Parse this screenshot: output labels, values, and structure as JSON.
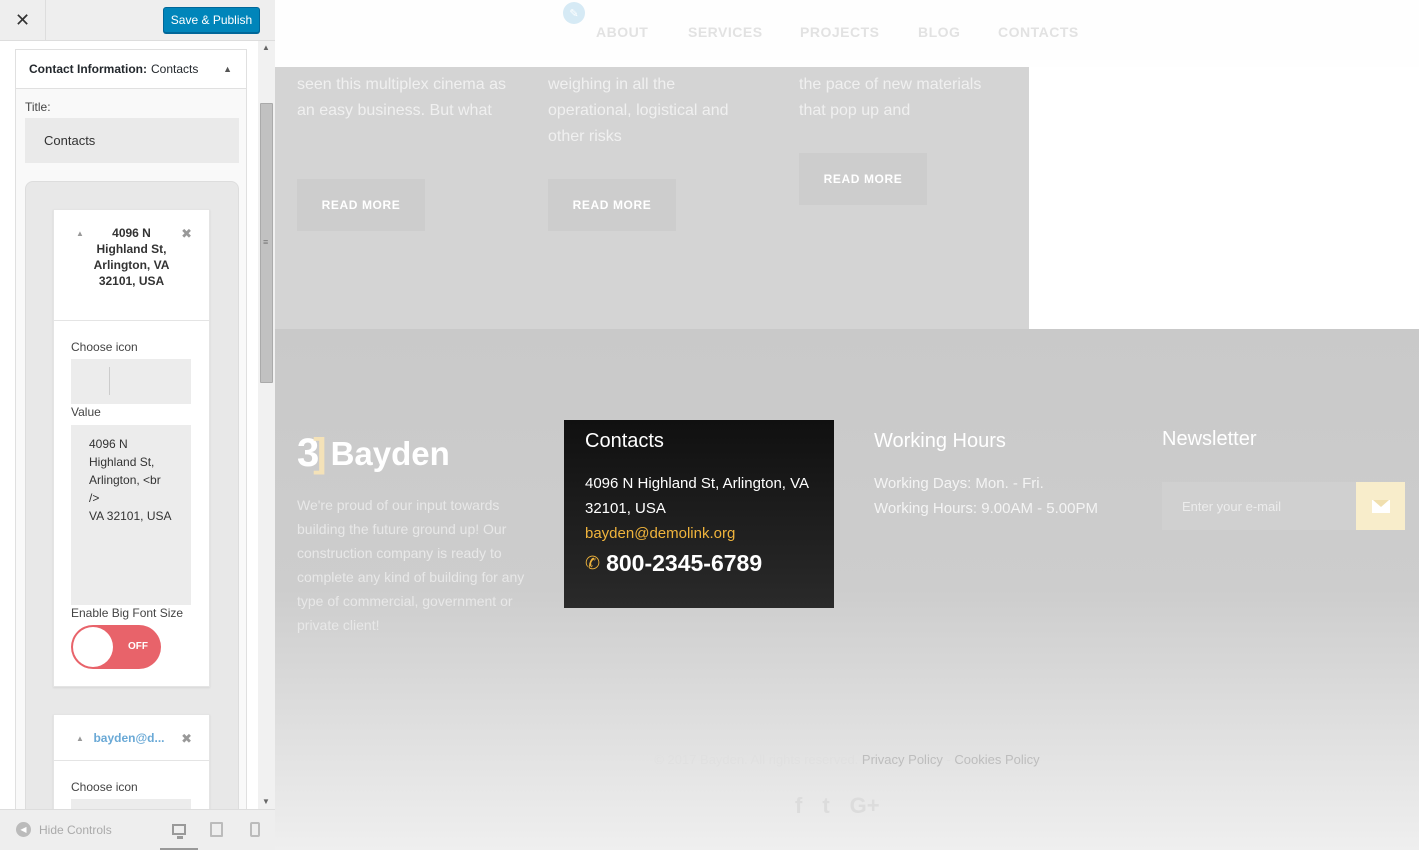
{
  "customizer": {
    "close_glyph": "✕",
    "publish_label": "Save & Publish",
    "section": {
      "prefix": "Contact Information:",
      "name": "Contacts"
    },
    "title_label": "Title:",
    "title_value": "Contacts",
    "items": [
      {
        "title": "4096 N Highland St, Arlington, VA 32101, USA",
        "choose_icon_label": "Choose icon",
        "value_label": "Value",
        "value": "4096 N Highland St, Arlington, <br />\nVA 32101, USA",
        "big_font_label": "Enable Big Font Size",
        "toggle_text": "OFF"
      },
      {
        "title": "bayden@d...",
        "choose_icon_label": "Choose icon"
      }
    ],
    "footer": {
      "hide_controls": "Hide Controls"
    }
  },
  "site": {
    "nav": [
      "ABOUT",
      "SERVICES",
      "PROJECTS",
      "BLOG",
      "CONTACTS"
    ],
    "posts": [
      {
        "excerpt": "seen this multiplex cinema as an easy business. But what",
        "button": "READ MORE"
      },
      {
        "excerpt": "weighing in all the operational, logistical and other risks",
        "button": "READ MORE"
      },
      {
        "excerpt": "the pace of new materials that pop up and",
        "button": "READ MORE"
      }
    ],
    "footer": {
      "logo_text": "Bayden",
      "about": "We're proud of our input towards building the future ground up! Our construction company is ready to complete any kind of building for any type of commercial, government or private client!",
      "contacts": {
        "title": "Contacts",
        "address": "4096 N Highland St, Arlington, VA 32101, USA",
        "email": "bayden@demolink.org",
        "phone": "800-2345-6789"
      },
      "hours": {
        "title": "Working Hours",
        "days": "Working Days: Mon. - Fri.",
        "time": "Working Hours: 9.00AM - 5.00PM"
      },
      "newsletter": {
        "title": "Newsletter",
        "placeholder": "Enter your e-mail"
      },
      "copyright": "© 2017 Bayden. All rights reserved.",
      "privacy": "Privacy Policy",
      "separator": " - ",
      "cookies": "Cookies Policy",
      "socials": [
        "f",
        "t",
        "G+"
      ]
    }
  },
  "colors": {
    "publish": "#0085ba",
    "toggle_off": "#e8636a",
    "accent": "#f0b43c"
  }
}
